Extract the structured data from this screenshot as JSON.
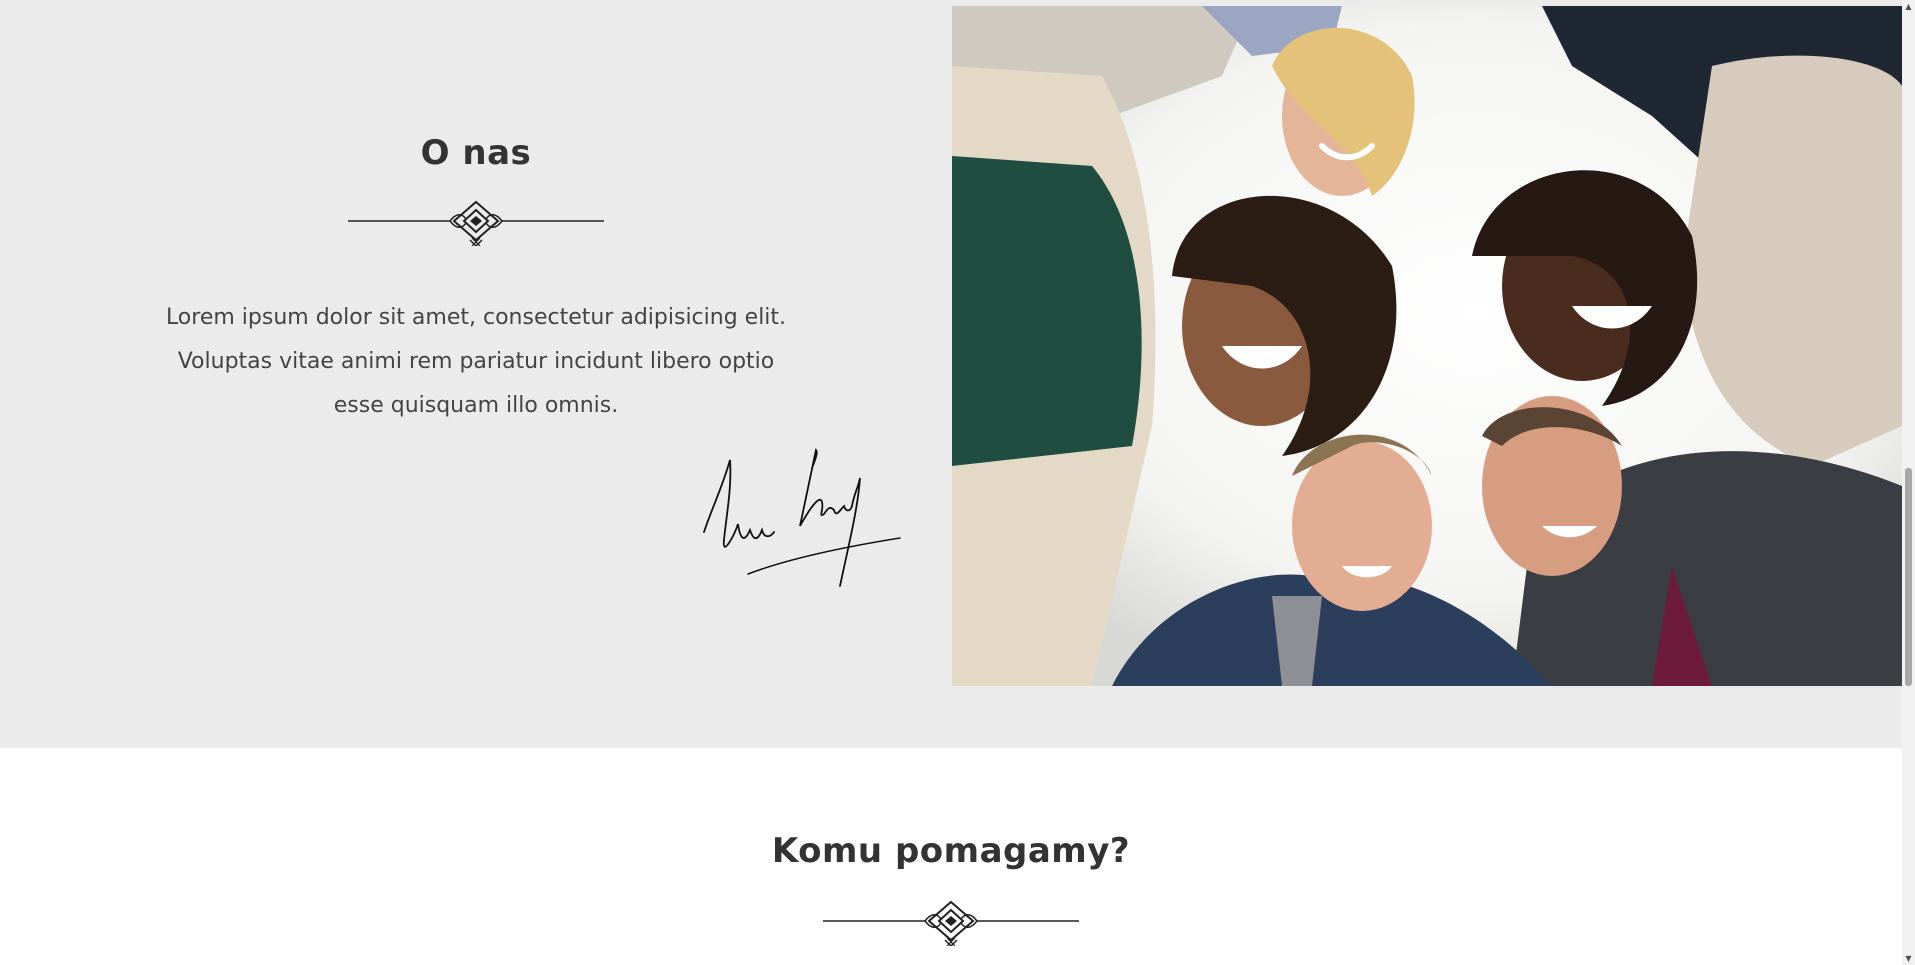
{
  "about": {
    "title": "O nas",
    "body": "Lorem ipsum dolor sit amet, consectetur adipisicing elit. Voluptas vitae animi rem pariatur incidunt libero optio esse quisquam illo omnis.",
    "ornament_icon": "ornament-divider-icon",
    "signature": "handwritten signature",
    "photo": "group of smiling colleagues in a huddle, viewed from below"
  },
  "help": {
    "title": "Komu pomagamy?",
    "ornament_icon": "ornament-divider-icon"
  },
  "colors": {
    "about_bg": "#ebebeb",
    "help_bg": "#ffffff",
    "heading_text": "#333333",
    "body_text": "#444444"
  }
}
